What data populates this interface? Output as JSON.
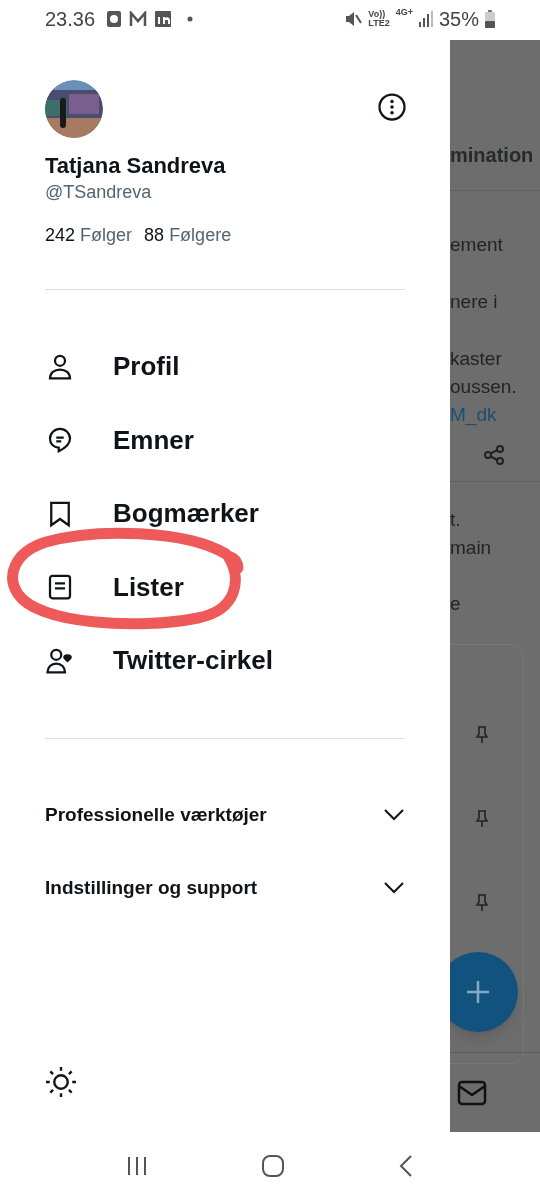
{
  "status_bar": {
    "time": "23.36",
    "volte_top": "Vo))",
    "volte_bottom": "LTE2",
    "network": "4G+",
    "battery": "35%"
  },
  "profile": {
    "name": "Tatjana Sandreva",
    "handle": "@TSandreva",
    "following_count": "242",
    "following_label": "Følger",
    "followers_count": "88",
    "followers_label": "Følgere"
  },
  "menu": [
    {
      "kind": "person",
      "label": "Profil"
    },
    {
      "kind": "topics",
      "label": "Emner"
    },
    {
      "kind": "bookmark",
      "label": "Bogmærker"
    },
    {
      "kind": "list",
      "label": "Lister"
    },
    {
      "kind": "circle",
      "label": "Twitter-cirkel"
    }
  ],
  "sections": [
    {
      "label": "Professionelle værktøjer",
      "expanded": false
    },
    {
      "label": "Indstillinger og support",
      "expanded": false
    }
  ],
  "background": {
    "header_fragment": "mination",
    "lines": [
      {
        "kind": "text",
        "text": "ement"
      },
      {
        "kind": "text",
        "text": "nere i"
      },
      {
        "kind": "text",
        "text": "kaster"
      },
      {
        "kind": "text",
        "text": "oussen."
      },
      {
        "kind": "link",
        "text": "M_dk"
      }
    ],
    "lines_2": [
      "t.",
      "main",
      "e"
    ]
  }
}
